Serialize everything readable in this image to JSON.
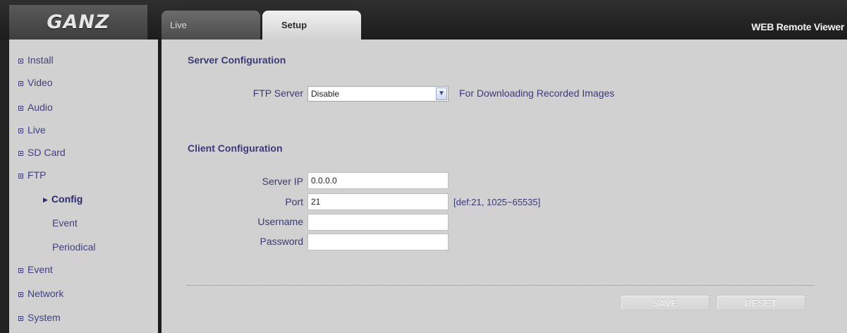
{
  "header": {
    "logo_text": "GANZ",
    "tabs": [
      {
        "label": "Live"
      },
      {
        "label": "Setup"
      }
    ],
    "app_title": "WEB Remote Viewer"
  },
  "sidebar": {
    "items": [
      {
        "label": "Install"
      },
      {
        "label": "Video"
      },
      {
        "label": "Audio"
      },
      {
        "label": "Live"
      },
      {
        "label": "SD Card"
      },
      {
        "label": "FTP"
      },
      {
        "label": "Event"
      },
      {
        "label": "Network"
      },
      {
        "label": "System"
      }
    ],
    "ftp_subitems": [
      {
        "label": "Config",
        "active": true
      },
      {
        "label": "Event"
      },
      {
        "label": "Periodical"
      }
    ]
  },
  "server_config": {
    "title": "Server Configuration",
    "ftp_server_label": "FTP Server",
    "ftp_server_value": "Disable",
    "ftp_server_hint": "For Downloading Recorded Images"
  },
  "client_config": {
    "title": "Client Configuration",
    "server_ip_label": "Server IP",
    "server_ip_value": "0.0.0.0",
    "port_label": "Port",
    "port_value": "21",
    "port_hint": "[def:21, 1025~65535]",
    "username_label": "Username",
    "username_value": "",
    "password_label": "Password",
    "password_value": ""
  },
  "buttons": {
    "save_label": "SAVE",
    "reset_label": "RESET"
  }
}
